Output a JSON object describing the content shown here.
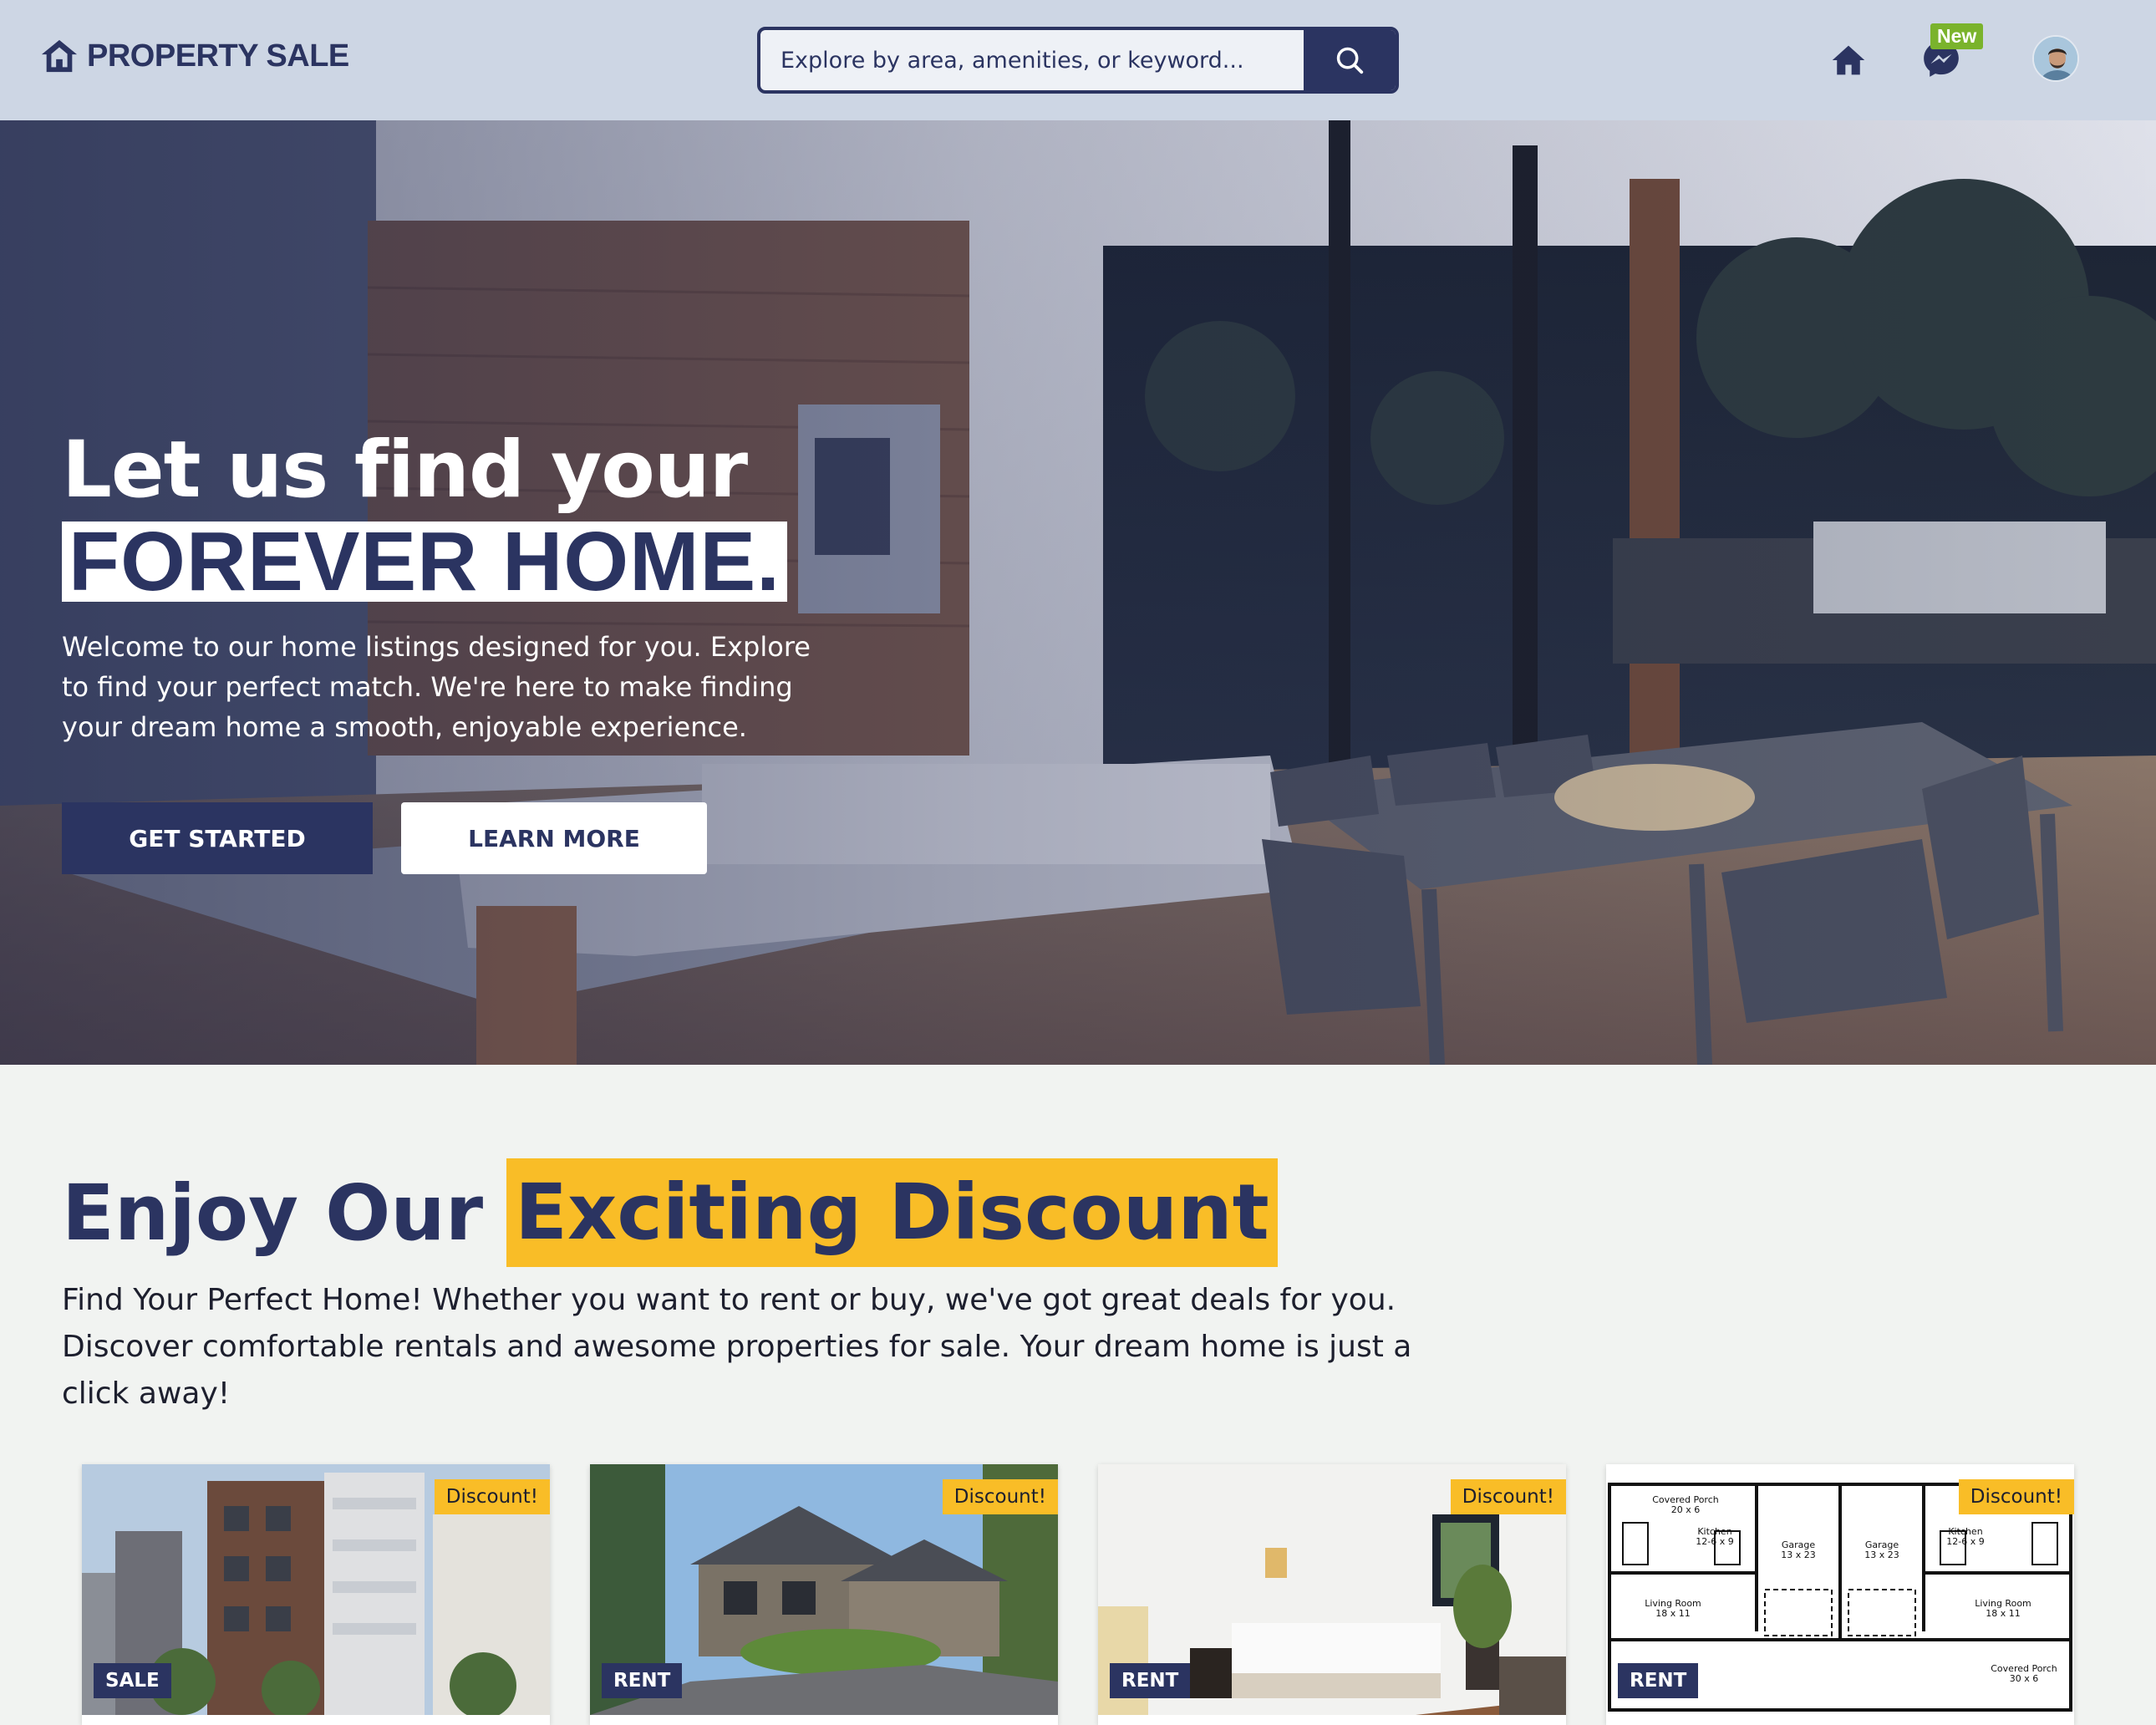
{
  "header": {
    "brand": "PROPERTY SALE",
    "search_placeholder": "Explore by area, amenities, or keyword...",
    "new_badge": "New"
  },
  "hero": {
    "title_line1": "Let us find your",
    "title_line2": "FOREVER HOME.",
    "description": "Welcome to our home listings designed for you. Explore to find your perfect match. We're here to make finding your dream home a smooth, enjoyable experience.",
    "primary_button": "GET STARTED",
    "secondary_button": "LEARN MORE"
  },
  "discount_section": {
    "title_plain": "Enjoy Our",
    "title_highlight": "Exciting Discount",
    "description": "Find Your Perfect Home! Whether you want to rent or buy, we've got great deals for you. Discover comfortable rentals and awesome properties for sale. Your dream home is just a click away!"
  },
  "cards": [
    {
      "badge": "Discount!",
      "type": "SALE",
      "image": "apartment-building"
    },
    {
      "badge": "Discount!",
      "type": "RENT",
      "image": "suburban-house"
    },
    {
      "badge": "Discount!",
      "type": "RENT",
      "image": "bedroom"
    },
    {
      "badge": "Discount!",
      "type": "RENT",
      "image": "floor-plan"
    }
  ],
  "floor_plan_labels": {
    "porch_top": "Covered Porch",
    "porch_top_size": "20 x 6",
    "garage": "Garage",
    "garage_size": "13 x 23",
    "kitchen": "Kitchen",
    "kitchen_size": "12-6 x 9",
    "living": "Living Room",
    "living_size": "18 x 11",
    "porch_bottom": "Covered Porch",
    "porch_bottom_size": "30 x 6"
  },
  "colors": {
    "primary": "#2b3461",
    "accent": "#f9bd27",
    "header_bg": "#cdd6e4",
    "page_bg": "#f1f3f1",
    "new_badge": "#7ab32c"
  },
  "icons": [
    "home-icon",
    "search-icon",
    "messenger-icon",
    "user-avatar"
  ]
}
